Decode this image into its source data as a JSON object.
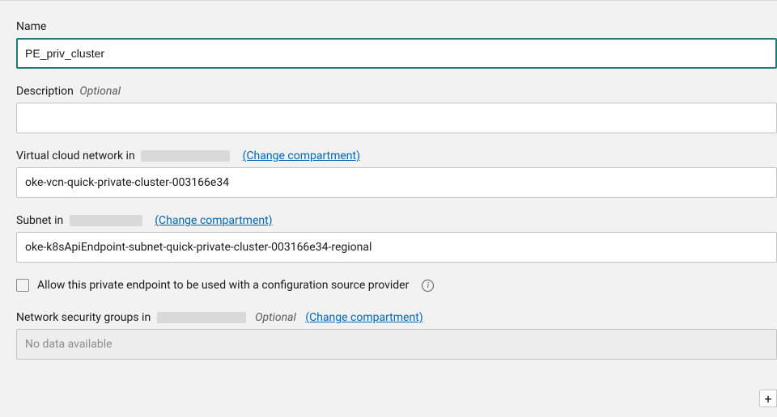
{
  "name": {
    "label": "Name",
    "value": "PE_priv_cluster"
  },
  "description": {
    "label": "Description",
    "optional": "Optional",
    "value": ""
  },
  "vcn": {
    "label_prefix": "Virtual cloud network in",
    "change_link": "(Change compartment)",
    "value": "oke-vcn-quick-private-cluster-003166e34"
  },
  "subnet": {
    "label_prefix": "Subnet in",
    "change_link": "(Change compartment)",
    "value": "oke-k8sApiEndpoint-subnet-quick-private-cluster-003166e34-regional"
  },
  "checkbox": {
    "label": "Allow this private endpoint to be used with a configuration source provider"
  },
  "nsg": {
    "label_prefix": "Network security groups in",
    "optional": "Optional",
    "change_link": "(Change compartment)",
    "placeholder": "No data available"
  }
}
